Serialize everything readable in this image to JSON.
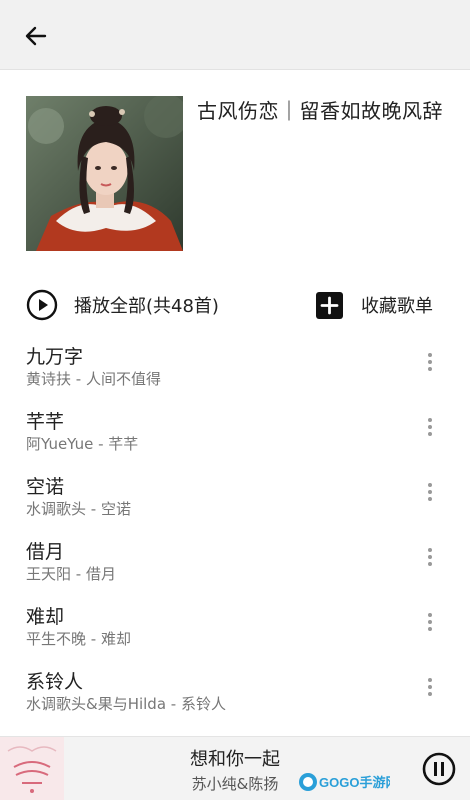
{
  "header": {
    "back_icon": "arrow-left-icon"
  },
  "playlist": {
    "title": "古风伤恋｜留香如故晚风辞",
    "cover_icon": "playlist-cover-image"
  },
  "actions": {
    "play_all_label": "播放全部(共48首)",
    "play_all_icon": "play-circle-icon",
    "collect_label": "收藏歌单",
    "collect_icon": "plus-square-icon"
  },
  "songs": [
    {
      "title": "九万字",
      "subtitle": "黄诗扶 - 人间不值得"
    },
    {
      "title": "芊芊",
      "subtitle": "阿YueYue - 芊芊"
    },
    {
      "title": "空诺",
      "subtitle": "水调歌头 - 空诺"
    },
    {
      "title": "借月",
      "subtitle": "王天阳 - 借月"
    },
    {
      "title": "难却",
      "subtitle": "平生不晚 - 难却"
    },
    {
      "title": "系铃人",
      "subtitle": "水调歌头&果与Hilda - 系铃人"
    }
  ],
  "player": {
    "title": "想和你一起",
    "artist": "苏小纯&陈扬",
    "art_icon": "album-art-image",
    "pause_icon": "pause-circle-icon"
  },
  "watermark": {
    "text": "GOGO手游网"
  }
}
